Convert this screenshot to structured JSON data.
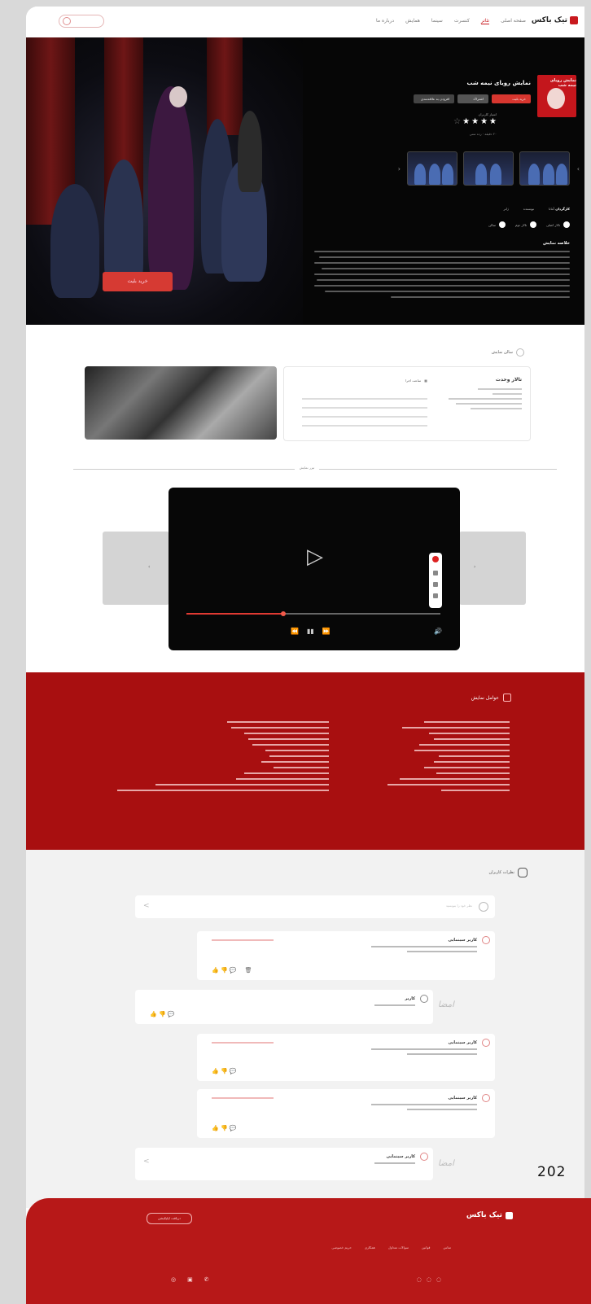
{
  "nav": {
    "brand": "تیک باکس",
    "links": [
      "صفحه اصلی",
      "تئاتر",
      "کنسرت",
      "سینما",
      "همایش",
      "درباره ما"
    ],
    "active_index": 1
  },
  "hero": {
    "title": "نمایش رویای نیمه شب",
    "cta": "خرید بلیت",
    "chip_buy": "خرید بلیت",
    "chip_share": "اشتراک",
    "chip_save": "افزودن به علاقه‌مندی",
    "rating_label": "امتیاز کاربران",
    "stars": "★★★★",
    "half_star": "☆",
    "sub_info": "۲۰ دقیقه · رده سنی",
    "director_label": "کارگردان",
    "director": "آمانا",
    "meta_2": "نویسنده",
    "meta_3": "ژانر",
    "radio_1": "تالار اصلی",
    "radio_2": "تالار دوم",
    "radio_3": "سالن",
    "desc_title": "خلاصه نمایش"
  },
  "place": {
    "section": "سالن نمایش",
    "name": "تالار وحدت",
    "sub": "ساعت اجرا"
  },
  "video": {
    "section": "تیزر نمایش",
    "progress": 0.38,
    "controls": [
      "⏪",
      "▮▮",
      "⏩"
    ],
    "volume": "🔊",
    "prev": "‹",
    "next": "›"
  },
  "cast": {
    "section": "عوامل نمایش"
  },
  "comments": {
    "section": "نظرات کاربران",
    "placeholder": "نظر خود را بنویسید",
    "user": "کاربر سینمایی",
    "reply_user": "کاربر",
    "actions": "👍 👎 💬",
    "trash": "🗑",
    "signature": "امضا",
    "send": "<"
  },
  "year": "202",
  "footer": {
    "brand": "تیک باکس",
    "button": "دریافت اپلیکیشن",
    "links": [
      "تماس",
      "قوانین",
      "سوالات متداول",
      "همکاری",
      "حریم خصوصی"
    ],
    "icons_left": [
      "◎",
      "▣",
      "✆"
    ],
    "icons_right": [
      "◌",
      "◌",
      "◌"
    ]
  },
  "colors": {
    "brand_red": "#c8191e",
    "cast_red": "#a80f10",
    "footer_red": "#b71818"
  }
}
